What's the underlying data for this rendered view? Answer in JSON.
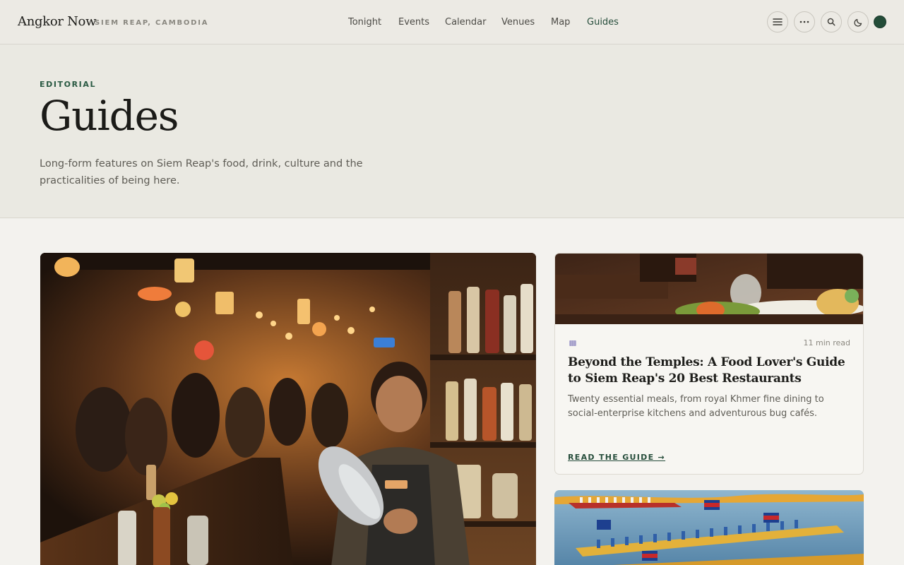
{
  "brand": {
    "name": "Angkor Now",
    "location": "SIEM REAP, CAMBODIA"
  },
  "nav": {
    "items": [
      {
        "label": "Tonight",
        "active": false
      },
      {
        "label": "Events",
        "active": false
      },
      {
        "label": "Calendar",
        "active": false
      },
      {
        "label": "Venues",
        "active": false
      },
      {
        "label": "Map",
        "active": false
      },
      {
        "label": "Guides",
        "active": true
      }
    ]
  },
  "toolbar": {
    "icons": [
      "menu-icon",
      "more-icon",
      "search-icon",
      "moon-icon"
    ],
    "accent": "#234c38"
  },
  "hero": {
    "eyebrow": "EDITORIAL",
    "title": "Guides",
    "description": "Long-form features on Siem Reap's food, drink, culture and the practicalities of being here."
  },
  "featured": {
    "image": "bar-bartender-photo"
  },
  "cards": [
    {
      "image": "restaurant-table-photo",
      "category_icon": "fork-knife-icon",
      "read_time": "11 min read",
      "title": "Beyond the Temples: A Food Lover's Guide to Siem Reap's 20 Best Restaurants",
      "description": "Twenty essential meals, from royal Khmer fine dining to social-enterprise kitchens and adventurous bug cafés.",
      "cta": "READ THE GUIDE →"
    },
    {
      "image": "boat-race-photo"
    }
  ]
}
